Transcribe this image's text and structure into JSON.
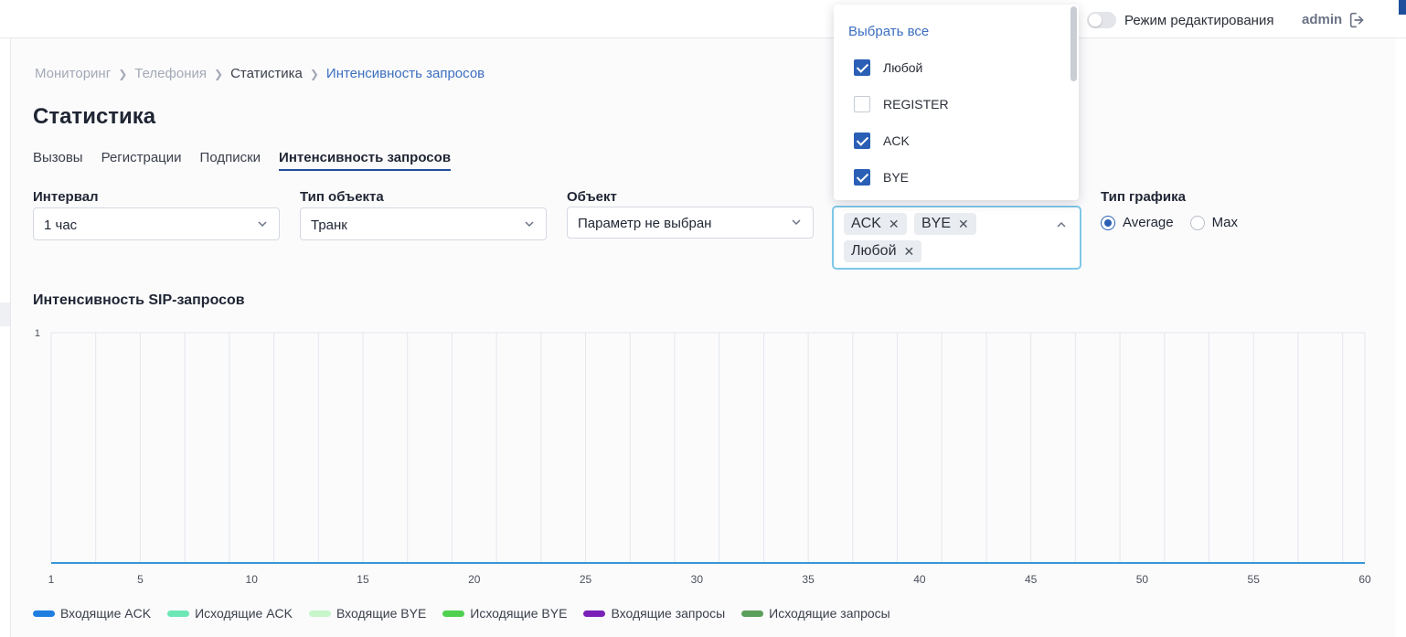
{
  "topbar": {
    "edit_mode_label": "Режим редактирования",
    "user_name": "admin"
  },
  "breadcrumb": [
    "Мониторинг",
    "Телефония",
    "Статистика",
    "Интенсивность запросов"
  ],
  "page_title": "Статистика",
  "tabs": [
    {
      "label": "Вызовы",
      "active": false
    },
    {
      "label": "Регистрации",
      "active": false
    },
    {
      "label": "Подписки",
      "active": false
    },
    {
      "label": "Интенсивность запросов",
      "active": true
    }
  ],
  "filters": {
    "interval": {
      "label": "Интервал",
      "value": "1 час"
    },
    "object_type": {
      "label": "Тип объекта",
      "value": "Транк"
    },
    "object": {
      "label": "Объект",
      "value": "Параметр не выбран"
    },
    "request_types": {
      "chips": [
        "ACK",
        "BYE",
        "Любой"
      ]
    },
    "chart_type": {
      "label": "Тип графика",
      "options": [
        "Average",
        "Max"
      ],
      "selected": "Average"
    }
  },
  "dropdown": {
    "select_all_label": "Выбрать все",
    "items": [
      {
        "label": "Любой",
        "checked": true
      },
      {
        "label": "REGISTER",
        "checked": false
      },
      {
        "label": "ACK",
        "checked": true
      },
      {
        "label": "BYE",
        "checked": true
      }
    ]
  },
  "chart_data": {
    "type": "line",
    "title": "Интенсивность SIP-запросов",
    "x": [
      1,
      2,
      3,
      4,
      5,
      6,
      7,
      8,
      9,
      10,
      11,
      12,
      13,
      14,
      15,
      16,
      17,
      18,
      19,
      20,
      21,
      22,
      23,
      24,
      25,
      26,
      27,
      28,
      29,
      30,
      31,
      32,
      33,
      34,
      35,
      36,
      37,
      38,
      39,
      40,
      41,
      42,
      43,
      44,
      45,
      46,
      47,
      48,
      49,
      50,
      51,
      52,
      53,
      54,
      55,
      56,
      57,
      58,
      59,
      60
    ],
    "x_ticks": [
      1,
      5,
      10,
      15,
      20,
      25,
      30,
      35,
      40,
      45,
      50,
      55,
      60
    ],
    "xlim": [
      1,
      60
    ],
    "ylim": [
      0,
      1
    ],
    "y_ticks": [
      1
    ],
    "grid": true,
    "legend_position": "bottom-left",
    "series": [
      {
        "name": "Входящие ACK",
        "color": "#1e7fe0",
        "values": [
          0,
          0,
          0,
          0,
          0,
          0,
          0,
          0,
          0,
          0,
          0,
          0,
          0,
          0,
          0,
          0,
          0,
          0,
          0,
          0,
          0,
          0,
          0,
          0,
          0,
          0,
          0,
          0,
          0,
          0,
          0,
          0,
          0,
          0,
          0,
          0,
          0,
          0,
          0,
          0,
          0,
          0,
          0,
          0,
          0,
          0,
          0,
          0,
          0,
          0,
          0,
          0,
          0,
          0,
          0,
          0,
          0,
          0,
          0,
          0
        ]
      },
      {
        "name": "Исходящие ACK",
        "color": "#6ee7b7",
        "values": [
          0,
          0,
          0,
          0,
          0,
          0,
          0,
          0,
          0,
          0,
          0,
          0,
          0,
          0,
          0,
          0,
          0,
          0,
          0,
          0,
          0,
          0,
          0,
          0,
          0,
          0,
          0,
          0,
          0,
          0,
          0,
          0,
          0,
          0,
          0,
          0,
          0,
          0,
          0,
          0,
          0,
          0,
          0,
          0,
          0,
          0,
          0,
          0,
          0,
          0,
          0,
          0,
          0,
          0,
          0,
          0,
          0,
          0,
          0,
          0
        ]
      },
      {
        "name": "Входящие BYE",
        "color": "#c6f6c9",
        "values": [
          0,
          0,
          0,
          0,
          0,
          0,
          0,
          0,
          0,
          0,
          0,
          0,
          0,
          0,
          0,
          0,
          0,
          0,
          0,
          0,
          0,
          0,
          0,
          0,
          0,
          0,
          0,
          0,
          0,
          0,
          0,
          0,
          0,
          0,
          0,
          0,
          0,
          0,
          0,
          0,
          0,
          0,
          0,
          0,
          0,
          0,
          0,
          0,
          0,
          0,
          0,
          0,
          0,
          0,
          0,
          0,
          0,
          0,
          0,
          0
        ]
      },
      {
        "name": "Исходящие BYE",
        "color": "#4fd14f",
        "values": [
          0,
          0,
          0,
          0,
          0,
          0,
          0,
          0,
          0,
          0,
          0,
          0,
          0,
          0,
          0,
          0,
          0,
          0,
          0,
          0,
          0,
          0,
          0,
          0,
          0,
          0,
          0,
          0,
          0,
          0,
          0,
          0,
          0,
          0,
          0,
          0,
          0,
          0,
          0,
          0,
          0,
          0,
          0,
          0,
          0,
          0,
          0,
          0,
          0,
          0,
          0,
          0,
          0,
          0,
          0,
          0,
          0,
          0,
          0,
          0
        ]
      },
      {
        "name": "Входящие запросы",
        "color": "#7a22b8",
        "values": [
          0,
          0,
          0,
          0,
          0,
          0,
          0,
          0,
          0,
          0,
          0,
          0,
          0,
          0,
          0,
          0,
          0,
          0,
          0,
          0,
          0,
          0,
          0,
          0,
          0,
          0,
          0,
          0,
          0,
          0,
          0,
          0,
          0,
          0,
          0,
          0,
          0,
          0,
          0,
          0,
          0,
          0,
          0,
          0,
          0,
          0,
          0,
          0,
          0,
          0,
          0,
          0,
          0,
          0,
          0,
          0,
          0,
          0,
          0,
          0
        ]
      },
      {
        "name": "Исходящие запросы",
        "color": "#5aa05a",
        "values": [
          0,
          0,
          0,
          0,
          0,
          0,
          0,
          0,
          0,
          0,
          0,
          0,
          0,
          0,
          0,
          0,
          0,
          0,
          0,
          0,
          0,
          0,
          0,
          0,
          0,
          0,
          0,
          0,
          0,
          0,
          0,
          0,
          0,
          0,
          0,
          0,
          0,
          0,
          0,
          0,
          0,
          0,
          0,
          0,
          0,
          0,
          0,
          0,
          0,
          0,
          0,
          0,
          0,
          0,
          0,
          0,
          0,
          0,
          0,
          0
        ]
      }
    ]
  },
  "colors": {
    "accent": "#1f4e9c",
    "link": "#3c6fbf",
    "focus": "#7ec8e8"
  }
}
